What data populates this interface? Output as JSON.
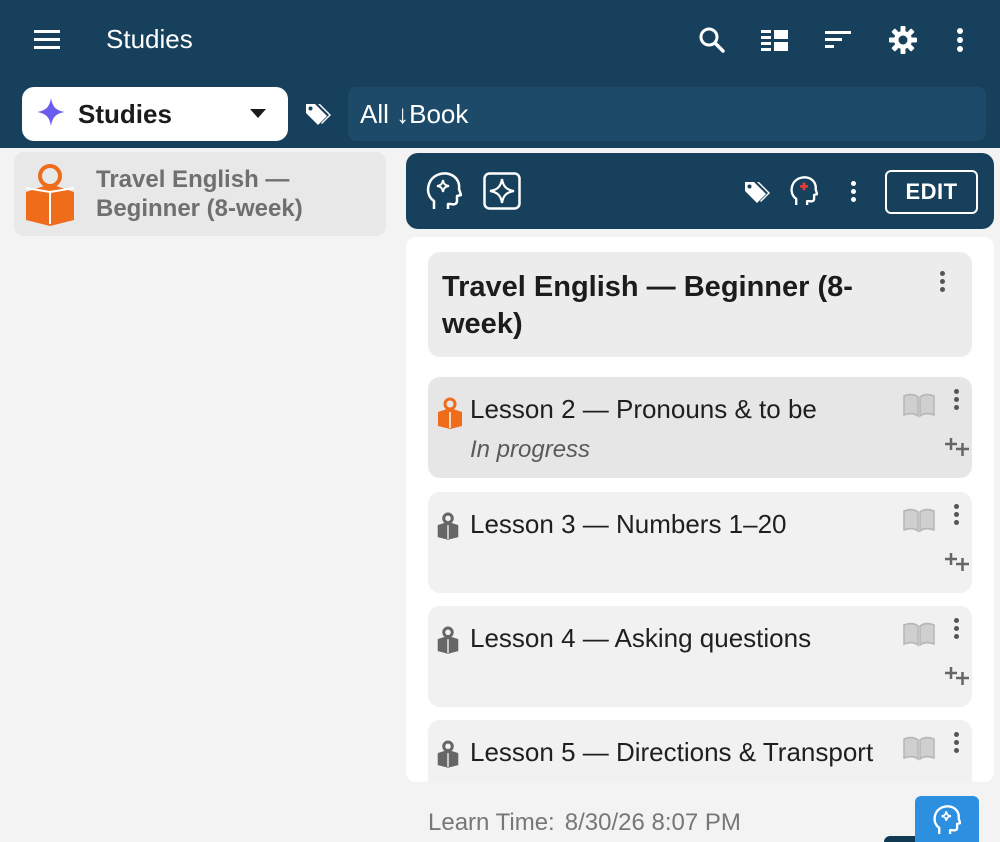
{
  "appbar": {
    "title": "Studies",
    "menu_icon": "hamburger-menu-icon",
    "toolbar_icons": [
      "search-icon",
      "view-list-icon",
      "sort-icon",
      "gear-icon",
      "more-vert-icon"
    ]
  },
  "selector": {
    "label": "Studies",
    "icon": "sparkle-icon"
  },
  "filter": {
    "text": "All ↓Book"
  },
  "left_list": [
    {
      "title": "Travel English — Beginner (8-week)"
    }
  ],
  "panel": {
    "edit_label": "EDIT",
    "book_title": "Travel English — Beginner (8-week)",
    "lessons": [
      {
        "title": "Lesson 2 — Pronouns & to be",
        "status": "In progress",
        "active": true
      },
      {
        "title": "Lesson 3 — Numbers 1–20",
        "status": ""
      },
      {
        "title": "Lesson 4 — Asking questions",
        "status": ""
      },
      {
        "title": "Lesson 5 — Directions & Transport",
        "status": ""
      }
    ]
  },
  "footer": {
    "learn_label": "Learn Time:",
    "learn_value": "8/30/26 8:07 PM"
  },
  "colors": {
    "appbar": "#16405c",
    "accent_orange": "#ee6c1a",
    "fab": "#2d8fe0",
    "sparkle": "#6b5cf0"
  }
}
